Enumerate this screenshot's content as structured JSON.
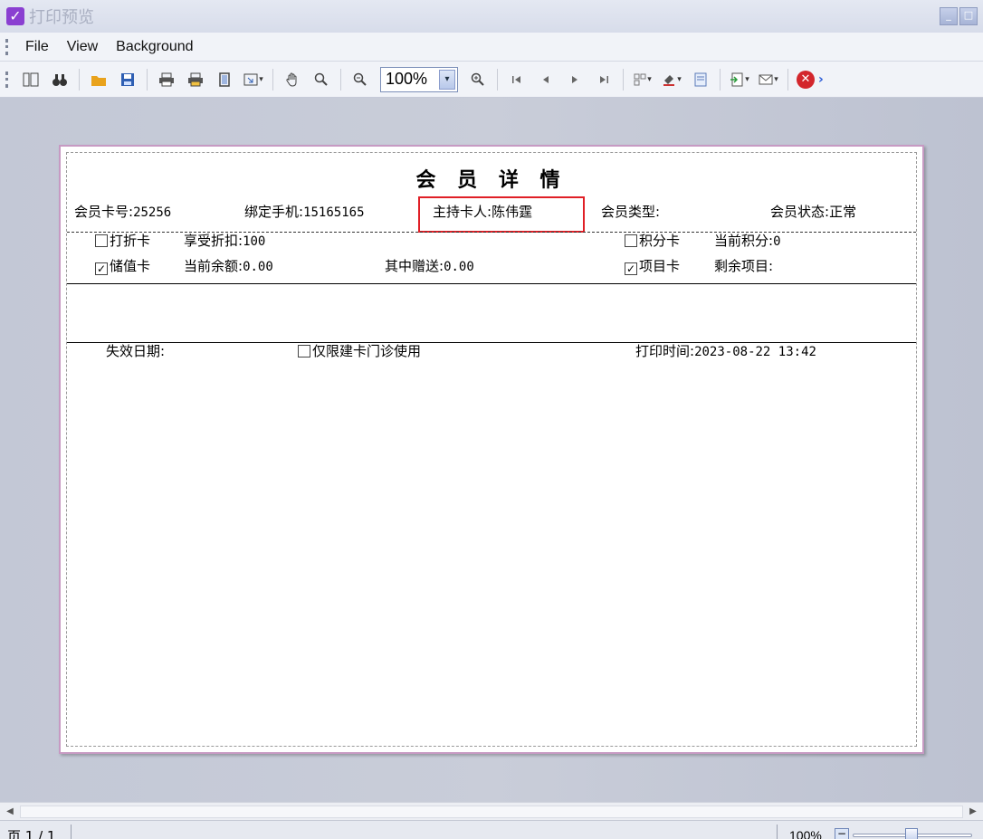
{
  "window": {
    "title": "打印预览"
  },
  "menu": {
    "items": [
      "File",
      "View",
      "Background"
    ]
  },
  "toolbar": {
    "zoom_value": "100%"
  },
  "document": {
    "title": "会 员 详 情",
    "card_no": {
      "label": "会员卡号:",
      "value": "25256"
    },
    "phone": {
      "label": "绑定手机:",
      "value": "15165165"
    },
    "holder": {
      "label": "主持卡人:",
      "value": "陈伟霆"
    },
    "member_type": {
      "label": "会员类型:",
      "value": ""
    },
    "member_status": {
      "label": "会员状态:",
      "value": "正常"
    },
    "discount_card": {
      "label": "打折卡",
      "checked": false
    },
    "discount": {
      "label": "享受折扣:",
      "value": "100"
    },
    "points_card": {
      "label": "积分卡",
      "checked": false
    },
    "current_points": {
      "label": "当前积分:",
      "value": "0"
    },
    "stored_card": {
      "label": "储值卡",
      "checked": true
    },
    "balance": {
      "label": "当前余额:",
      "value": "0.00"
    },
    "gift": {
      "label": "其中赠送:",
      "value": "0.00"
    },
    "item_card": {
      "label": "项目卡",
      "checked": true
    },
    "remaining_items": {
      "label": "剩余项目:",
      "value": ""
    },
    "expiry": {
      "label": "失效日期:",
      "value": ""
    },
    "clinic_only": {
      "label": "仅限建卡门诊使用",
      "checked": false
    },
    "print_time": {
      "label": "打印时间:",
      "value": "2023-08-22 13:42"
    }
  },
  "status": {
    "page": "页 1 / 1",
    "zoom": "100%"
  },
  "colors": {
    "highlight": "#e01f26",
    "page_border": "#c79ac3",
    "workspace": "#c3c8d6"
  }
}
